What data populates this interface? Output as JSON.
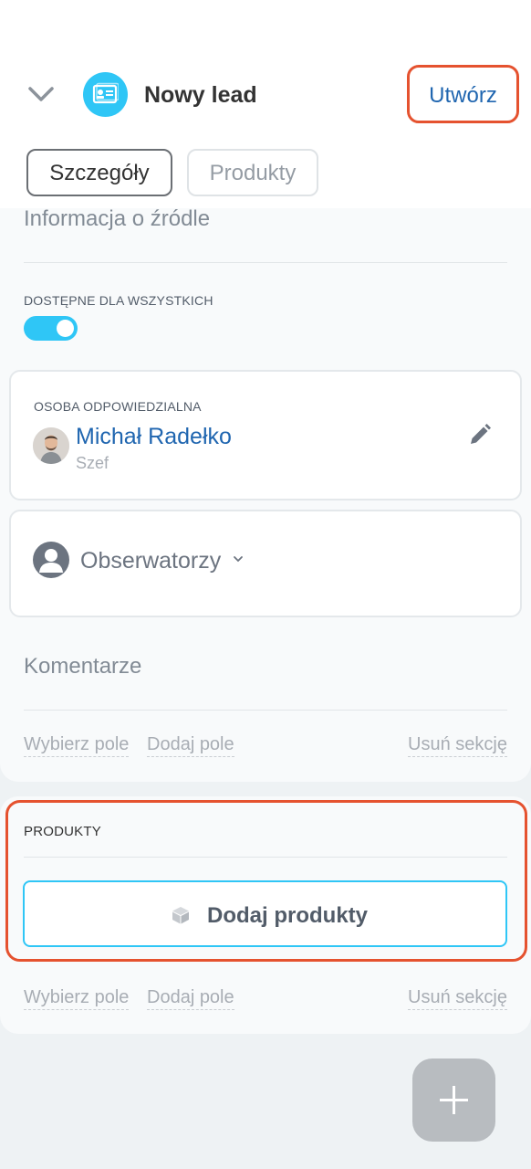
{
  "header": {
    "title": "Nowy lead",
    "create_label": "Utwórz",
    "icons": [
      "chevron-down-icon",
      "lead-card-icon"
    ]
  },
  "tabs": [
    {
      "label": "Szczegóły",
      "selected": true
    },
    {
      "label": "Produkty",
      "selected": false
    }
  ],
  "details": {
    "source_info_label": "Informacja o źródle",
    "visibility_label": "DOSTĘPNE DLA WSZYSTKICH",
    "visibility_on": true,
    "responsible": {
      "label": "OSOBA ODPOWIEDZIALNA",
      "name": "Michał Radełko",
      "role": "Szef"
    },
    "observers_label": "Obserwatorzy",
    "comments_label": "Komentarze",
    "actions": {
      "select_field": "Wybierz pole",
      "add_field": "Dodaj pole",
      "delete_section": "Usuń sekcję"
    }
  },
  "products": {
    "section_title": "PRODUKTY",
    "add_button": "Dodaj produkty",
    "actions": {
      "select_field": "Wybierz pole",
      "add_field": "Dodaj pole",
      "delete_section": "Usuń sekcję"
    }
  },
  "colors": {
    "accent": "#2fc6f6",
    "link": "#2066b0",
    "highlight": "#e5522f"
  }
}
